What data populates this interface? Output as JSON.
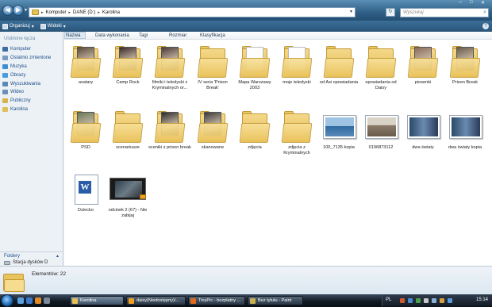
{
  "address": {
    "crumbs": [
      "Komputer",
      "DANE (D:)",
      "Karolina"
    ],
    "search_placeholder": "Wyszukaj"
  },
  "toolbar": {
    "organize": "Organizuj",
    "views": "Widoki"
  },
  "sidebar": {
    "favorites_title": "Ulubione łącza",
    "items": [
      {
        "label": "Komputer",
        "color": "#3a6ea5"
      },
      {
        "label": "Ostatnio zmienione",
        "color": "#7a9cc4"
      },
      {
        "label": "Muzyka",
        "color": "#3c8fd1"
      },
      {
        "label": "Obrazy",
        "color": "#4c9adb"
      },
      {
        "label": "Wyszukiwania",
        "color": "#5b87b6"
      },
      {
        "label": "Wideo",
        "color": "#6a8fb8"
      },
      {
        "label": "Publiczny",
        "color": "#d7b34a"
      },
      {
        "label": "Karolina",
        "color": "#e0bf5a"
      }
    ],
    "folders_label": "Foldery",
    "drive_label": "Stacja dysków D"
  },
  "columns": [
    "Nazwa",
    "Data wykonania",
    "Tagi",
    "Rozmiar",
    "Klasyfikacja"
  ],
  "items": [
    {
      "label": "avatary",
      "kind": "folder",
      "tint": "#5a4a3a"
    },
    {
      "label": "Camp Rock",
      "kind": "folder",
      "tint": "#3b2a2a"
    },
    {
      "label": "filmiki i teledyski z Kryminalnych or...",
      "kind": "folder",
      "tint": "#4a3a3a"
    },
    {
      "label": "IV seria 'Prison Break'",
      "kind": "folder",
      "tint": ""
    },
    {
      "label": "Mapa Warszawy 2003",
      "kind": "folder",
      "tint": "paper"
    },
    {
      "label": "moje teledyski",
      "kind": "folder",
      "tint": "paper"
    },
    {
      "label": "od Asi opowiadania",
      "kind": "folder",
      "tint": ""
    },
    {
      "label": "opowiadania od Daisy",
      "kind": "folder",
      "tint": ""
    },
    {
      "label": "piosenki",
      "kind": "folder",
      "tint": "#8a6a5a"
    },
    {
      "label": "Prison Break",
      "kind": "folder",
      "tint": "#6a5a4a"
    },
    {
      "label": "PSD",
      "kind": "folder",
      "tint": "#6a7a5a"
    },
    {
      "label": "scenariusze",
      "kind": "folder",
      "tint": ""
    },
    {
      "label": "sceniki z prison break",
      "kind": "folder",
      "tint": "#2a2a2a"
    },
    {
      "label": "skanowane",
      "kind": "folder",
      "tint": "#3a3a3a"
    },
    {
      "label": "zdjęcia",
      "kind": "folder",
      "tint": ""
    },
    {
      "label": "zdjęcia z Kryminalnych",
      "kind": "folder",
      "tint": ""
    },
    {
      "label": "100_7135 kopia",
      "kind": "pic",
      "tint": "linear-gradient(#9ec3e3 45%, #2f6aa0 46%, #5a8ab8)"
    },
    {
      "label": "0196873112",
      "kind": "pic",
      "tint": "linear-gradient(#d9d2c6 40%, #8a7a6a 42%, #6a5a4a)"
    },
    {
      "label": "dwa światy",
      "kind": "pic",
      "tint": "linear-gradient(90deg, #2a4a6a, #6a8ab0 50%, #2a3a5a)"
    },
    {
      "label": "dwa światy kopia",
      "kind": "pic",
      "tint": "linear-gradient(90deg, #2a4a6a, #6a8ab0 50%, #2a3a5a)"
    },
    {
      "label": "Dziecko",
      "kind": "doc",
      "tint": ""
    },
    {
      "label": "odcinek 2 (67) - Nie zabijaj",
      "kind": "video",
      "tint": ""
    }
  ],
  "details": {
    "count": "Elementów: 22"
  },
  "taskbar": {
    "tasks": [
      {
        "label": "Karolina",
        "color": "#e6bf55",
        "active": true
      },
      {
        "label": "daisy(Niedostępny)/...",
        "color": "#f0a020",
        "active": false
      },
      {
        "label": "TinyPic - bezpłatny ...",
        "color": "#e06a20",
        "active": false
      },
      {
        "label": "Bez tytułu - Paint",
        "color": "#c9b050",
        "active": false
      }
    ],
    "lang": "PL",
    "clock": "15:14"
  }
}
